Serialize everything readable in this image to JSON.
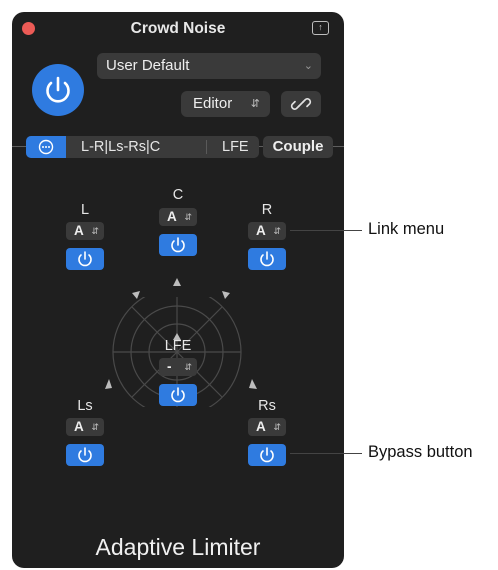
{
  "window": {
    "title": "Crowd Noise",
    "plugin_name": "Adaptive Limiter"
  },
  "header": {
    "preset": "User Default",
    "editor_label": "Editor",
    "link_icon": "link-icon",
    "expand_icon": "expand-icon"
  },
  "format_bar": {
    "tabs": [
      {
        "label": "L-R|Ls-Rs|C"
      },
      {
        "label": "LFE"
      }
    ],
    "couple_label": "Couple"
  },
  "channels": {
    "L": {
      "label": "L",
      "link": "A"
    },
    "C": {
      "label": "C",
      "link": "A"
    },
    "R": {
      "label": "R",
      "link": "A"
    },
    "LFE": {
      "label": "LFE",
      "link": "-"
    },
    "Ls": {
      "label": "Ls",
      "link": "A"
    },
    "Rs": {
      "label": "Rs",
      "link": "A"
    }
  },
  "callouts": {
    "link_menu": "Link menu",
    "bypass_button": "Bypass button"
  },
  "colors": {
    "panel": "#1f1f1f",
    "accent": "#2f7be0",
    "control": "#3a3a3a",
    "close": "#ec5b56"
  }
}
